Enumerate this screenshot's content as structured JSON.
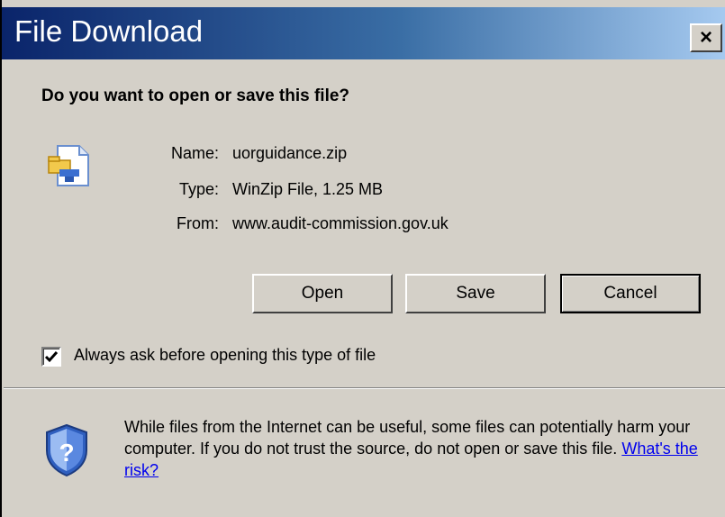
{
  "window": {
    "title": "File Download",
    "close_label": "×"
  },
  "prompt": {
    "question": "Do you want to open or save this file?"
  },
  "file": {
    "icon": "zip-file-icon",
    "name_label": "Name:",
    "name_value": "uorguidance.zip",
    "type_label": "Type:",
    "type_value": "WinZip File, 1.25 MB",
    "from_label": "From:",
    "from_value": "www.audit-commission.gov.uk"
  },
  "buttons": {
    "open": "Open",
    "save": "Save",
    "cancel": "Cancel"
  },
  "option": {
    "checked": true,
    "label": "Always ask before opening this type of file"
  },
  "warning": {
    "icon": "security-shield-icon",
    "text": "While files from the Internet can be useful, some files can potentially harm your computer. If you do not trust the source, do not open or save this file.",
    "link": "What's the risk?"
  },
  "colors": {
    "titlebar_start": "#0a246a",
    "titlebar_end": "#a6caf0",
    "dialog_bg": "#d4d0c8",
    "link": "#0000ee"
  }
}
